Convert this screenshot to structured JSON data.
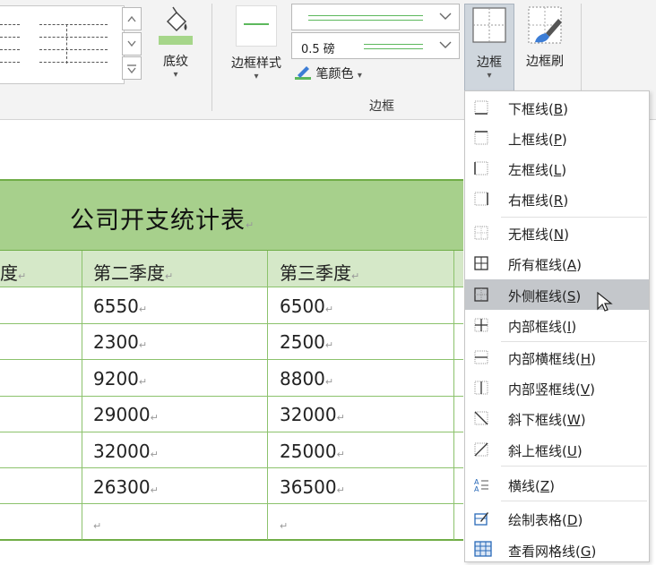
{
  "ribbon": {
    "shading_label": "底纹",
    "border_style_label": "边框样式",
    "line_weight_value": "0.5 磅",
    "pen_color_label": "笔颜色",
    "border_group_label": "边框",
    "borders_button_label": "边框",
    "border_painter_label": "边框刷",
    "accent_color": "#70ad47"
  },
  "table": {
    "title": "公司开支统计表",
    "headers": [
      "度",
      "第二季度",
      "第三季度"
    ],
    "rows": [
      [
        "6550",
        "6500"
      ],
      [
        "2300",
        "2500"
      ],
      [
        "9200",
        "8800"
      ],
      [
        "29000",
        "32000"
      ],
      [
        "32000",
        "25000"
      ],
      [
        "26300",
        "36500"
      ],
      [
        "",
        ""
      ]
    ],
    "header_fill": "#a7d08c",
    "subheader_fill": "#d5e8c8"
  },
  "menu": {
    "items": [
      {
        "label": "下框线",
        "key": "B",
        "icon": "bottom-border-icon"
      },
      {
        "label": "上框线",
        "key": "P",
        "icon": "top-border-icon"
      },
      {
        "label": "左框线",
        "key": "L",
        "icon": "left-border-icon"
      },
      {
        "label": "右框线",
        "key": "R",
        "icon": "right-border-icon"
      },
      {
        "label": "无框线",
        "key": "N",
        "icon": "no-border-icon"
      },
      {
        "label": "所有框线",
        "key": "A",
        "icon": "all-borders-icon"
      },
      {
        "label": "外侧框线",
        "key": "S",
        "icon": "outside-borders-icon"
      },
      {
        "label": "内部框线",
        "key": "I",
        "icon": "inside-borders-icon"
      },
      {
        "label": "内部横框线",
        "key": "H",
        "icon": "inside-horizontal-border-icon"
      },
      {
        "label": "内部竖框线",
        "key": "V",
        "icon": "inside-vertical-border-icon"
      },
      {
        "label": "斜下框线",
        "key": "W",
        "icon": "diagonal-down-border-icon"
      },
      {
        "label": "斜上框线",
        "key": "U",
        "icon": "diagonal-up-border-icon"
      },
      {
        "label": "横线",
        "key": "Z",
        "icon": "horizontal-line-icon"
      },
      {
        "label": "绘制表格",
        "key": "D",
        "icon": "draw-table-icon"
      },
      {
        "label": "查看网格线",
        "key": "G",
        "icon": "view-gridlines-icon"
      }
    ],
    "highlighted": "外侧框线"
  }
}
